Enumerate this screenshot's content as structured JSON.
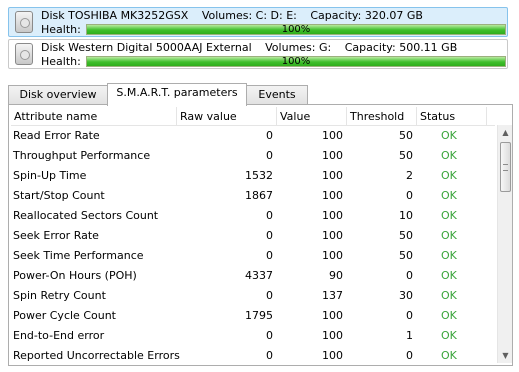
{
  "disks": [
    {
      "name": "Disk TOSHIBA MK3252GSX",
      "volumes": "Volumes: C: D: E:",
      "capacity": "Capacity: 320.07 GB",
      "health_label": "Health:",
      "health_value": "100%",
      "health_fraction": 1.0,
      "selected": true
    },
    {
      "name": "Disk Western Digital 5000AAJ External",
      "volumes": "Volumes: G:",
      "capacity": "Capacity: 500.11 GB",
      "health_label": "Health:",
      "health_value": "100%",
      "health_fraction": 1.0,
      "selected": false
    }
  ],
  "tabs": [
    {
      "label": "Disk overview"
    },
    {
      "label": "S.M.A.R.T. parameters"
    },
    {
      "label": "Events"
    }
  ],
  "active_tab": 1,
  "table": {
    "headers": {
      "name": "Attribute name",
      "raw": "Raw value",
      "value": "Value",
      "threshold": "Threshold",
      "status": "Status"
    },
    "rows": [
      {
        "name": "Read Error Rate",
        "raw": "0",
        "value": "100",
        "threshold": "50",
        "status": "OK"
      },
      {
        "name": "Throughput Performance",
        "raw": "0",
        "value": "100",
        "threshold": "50",
        "status": "OK"
      },
      {
        "name": "Spin-Up Time",
        "raw": "1532",
        "value": "100",
        "threshold": "2",
        "status": "OK"
      },
      {
        "name": "Start/Stop Count",
        "raw": "1867",
        "value": "100",
        "threshold": "0",
        "status": "OK"
      },
      {
        "name": "Reallocated Sectors Count",
        "raw": "0",
        "value": "100",
        "threshold": "10",
        "status": "OK"
      },
      {
        "name": "Seek Error Rate",
        "raw": "0",
        "value": "100",
        "threshold": "50",
        "status": "OK"
      },
      {
        "name": "Seek Time Performance",
        "raw": "0",
        "value": "100",
        "threshold": "50",
        "status": "OK"
      },
      {
        "name": "Power-On Hours (POH)",
        "raw": "4337",
        "value": "90",
        "threshold": "0",
        "status": "OK"
      },
      {
        "name": "Spin Retry Count",
        "raw": "0",
        "value": "137",
        "threshold": "30",
        "status": "OK"
      },
      {
        "name": "Power Cycle Count",
        "raw": "1795",
        "value": "100",
        "threshold": "0",
        "status": "OK"
      },
      {
        "name": "End-to-End error",
        "raw": "0",
        "value": "100",
        "threshold": "1",
        "status": "OK"
      },
      {
        "name": "Reported Uncorrectable Errors",
        "raw": "0",
        "value": "100",
        "threshold": "0",
        "status": "OK"
      }
    ]
  },
  "colors": {
    "status_ok": "#39a43a",
    "health_bar": "#3fbf2c",
    "selected_disk_bg": "#dbeefb"
  },
  "icons": {
    "disk": "hard-disk-icon",
    "scroll_up": "scroll-up-arrow",
    "scroll_down": "scroll-down-arrow"
  }
}
